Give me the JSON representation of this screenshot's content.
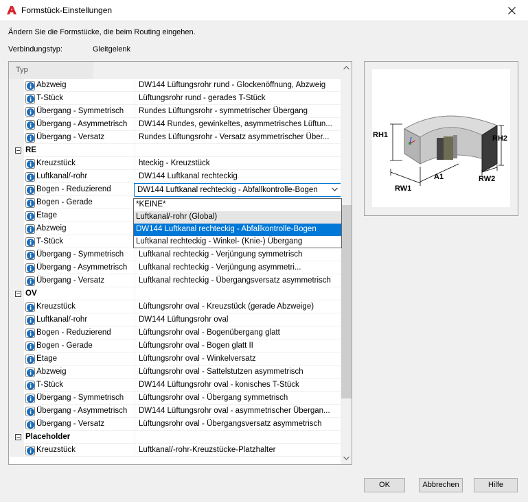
{
  "window": {
    "title": "Formstück-Einstellungen"
  },
  "description": "Ändern Sie die Formstücke, die beim Routing eingehen.",
  "connection": {
    "label": "Verbindungstyp:",
    "value": "Gleitgelenk"
  },
  "grid": {
    "header": "Typ",
    "rows": [
      {
        "kind": "item",
        "name": "Abzweig",
        "value": "DW144 Lüftungsrohr rund - Glockenöffnung, Abzweig"
      },
      {
        "kind": "item",
        "name": "T-Stück",
        "value": "Lüftungsrohr rund - gerades T-Stück"
      },
      {
        "kind": "item",
        "name": "Übergang - Symmetrisch",
        "value": "Rundes Lüftungsrohr - symmetrischer Übergang"
      },
      {
        "kind": "item",
        "name": "Übergang - Asymmetrisch",
        "value": "DW144 Rundes, gewinkeltes, asymmetrisches Lüftun..."
      },
      {
        "kind": "item",
        "name": "Übergang - Versatz",
        "value": "Rundes Lüftungsrohr - Versatz asymmetrischer Über..."
      },
      {
        "kind": "category",
        "name": "RE",
        "value": ""
      },
      {
        "kind": "item",
        "name": "Kreuzstück",
        "value": "hteckig - Kreuzstück"
      },
      {
        "kind": "item",
        "name": "Luftkanal/-rohr",
        "value": "DW144 Luftkanal rechteckig"
      },
      {
        "kind": "item",
        "name": "Bogen - Reduzierend",
        "value": "DW144 Luftkanal rechteckig - Abfallkontrolle-Bogen",
        "editing": true
      },
      {
        "kind": "item",
        "name": "Bogen - Gerade",
        "value": ""
      },
      {
        "kind": "item",
        "name": "Etage",
        "value": ""
      },
      {
        "kind": "item",
        "name": "Abzweig",
        "value": ""
      },
      {
        "kind": "item",
        "name": "T-Stück",
        "value": ""
      },
      {
        "kind": "item",
        "name": "Übergang - Symmetrisch",
        "value": "Luftkanal rechteckig - Verjüngung symmetrisch"
      },
      {
        "kind": "item",
        "name": "Übergang - Asymmetrisch",
        "value": "Luftkanal rechteckig - Verjüngung asymmetri..."
      },
      {
        "kind": "item",
        "name": "Übergang - Versatz",
        "value": "Luftkanal rechteckig - Übergangsversatz asymmetrisch"
      },
      {
        "kind": "category",
        "name": "OV",
        "value": ""
      },
      {
        "kind": "item",
        "name": "Kreuzstück",
        "value": "Lüftungsrohr oval - Kreuzstück (gerade Abzweige)"
      },
      {
        "kind": "item",
        "name": "Luftkanal/-rohr",
        "value": "DW144 Lüftungsrohr oval"
      },
      {
        "kind": "item",
        "name": "Bogen - Reduzierend",
        "value": "Lüftungsrohr oval - Bogenübergang glatt"
      },
      {
        "kind": "item",
        "name": "Bogen - Gerade",
        "value": "Lüftungsrohr oval - Bogen glatt II"
      },
      {
        "kind": "item",
        "name": "Etage",
        "value": "Lüftungsrohr oval - Winkelversatz"
      },
      {
        "kind": "item",
        "name": "Abzweig",
        "value": "Lüftungsrohr oval - Sattelstutzen asymmetrisch"
      },
      {
        "kind": "item",
        "name": "T-Stück",
        "value": "DW144 Lüftungsrohr oval - konisches T-Stück"
      },
      {
        "kind": "item",
        "name": "Übergang - Symmetrisch",
        "value": "Lüftungsrohr oval - Übergang symmetrisch"
      },
      {
        "kind": "item",
        "name": "Übergang - Asymmetrisch",
        "value": "DW144 Lüftungsrohr oval - asymmetrischer Übergan..."
      },
      {
        "kind": "item",
        "name": "Übergang - Versatz",
        "value": "Lüftungsrohr oval - Übergangsversatz asymmetrisch"
      },
      {
        "kind": "category",
        "name": "Placeholder",
        "value": ""
      },
      {
        "kind": "item",
        "name": "Kreuzstück",
        "value": "Luftkanal/-rohr-Kreuzstücke-Platzhalter"
      }
    ]
  },
  "dropdown": {
    "options": [
      "*KEINE*",
      "Luftkanal/-rohr (Global)",
      "DW144 Luftkanal rechteckig - Abfallkontrolle-Bogen",
      "Luftkanal rechteckig - Winkel- (Knie-) Übergang"
    ],
    "hover_index": 1,
    "selected_index": 2
  },
  "preview": {
    "labels": {
      "rh1": "RH1",
      "rh2": "RH2",
      "a1": "A1",
      "rw1": "RW1",
      "rw2": "RW2"
    }
  },
  "buttons": {
    "ok": "OK",
    "cancel": "Abbrechen",
    "help": "Hilfe"
  },
  "colors": {
    "selection": "#0078d7",
    "info_icon": "#1a6bb8",
    "app_icon": "#d7262c"
  },
  "icons": {
    "app": "autocad-a-icon",
    "close": "close-icon",
    "row": "info-icon",
    "scroll_up": "chevron-up-icon",
    "scroll_down": "chevron-down-icon",
    "combo": "chevron-down-icon"
  }
}
